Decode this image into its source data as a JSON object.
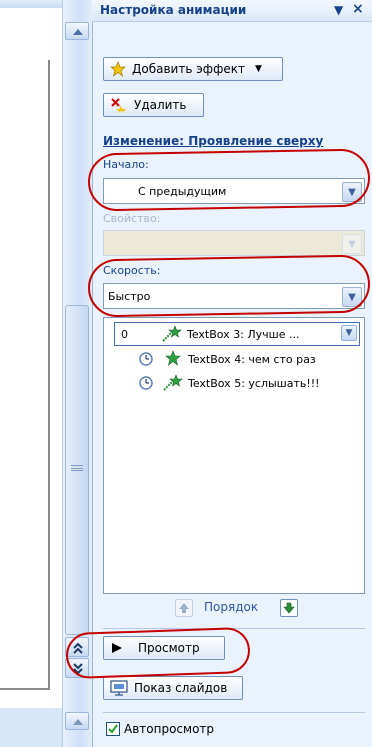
{
  "pane": {
    "title": "Настройка анимации",
    "header_dropdown": "▼",
    "close": "×"
  },
  "actions": {
    "add_effect": "Добавить эффект",
    "remove": "Удалить"
  },
  "change_title": "Изменение: Проявление сверху",
  "start": {
    "label": "Начало:",
    "value": "С предыдущим"
  },
  "property": {
    "label": "Свойство:",
    "value": ""
  },
  "speed": {
    "label": "Скорость:",
    "value": "Быстро"
  },
  "animations": [
    {
      "index": "0",
      "name": "TextBox 3: Лучше ...",
      "selected": true
    },
    {
      "index": "",
      "name": "TextBox 4: чем сто раз",
      "selected": false
    },
    {
      "index": "",
      "name": "TextBox 5: услышать!!!",
      "selected": false
    }
  ],
  "order_label": "Порядок",
  "preview_button": "Просмотр",
  "slideshow_button": "Показ слайдов",
  "autopreview": {
    "label": "Автопросмотр",
    "checked": true
  },
  "colors": {
    "accent": "#15428b",
    "annotation": "#c40000"
  }
}
